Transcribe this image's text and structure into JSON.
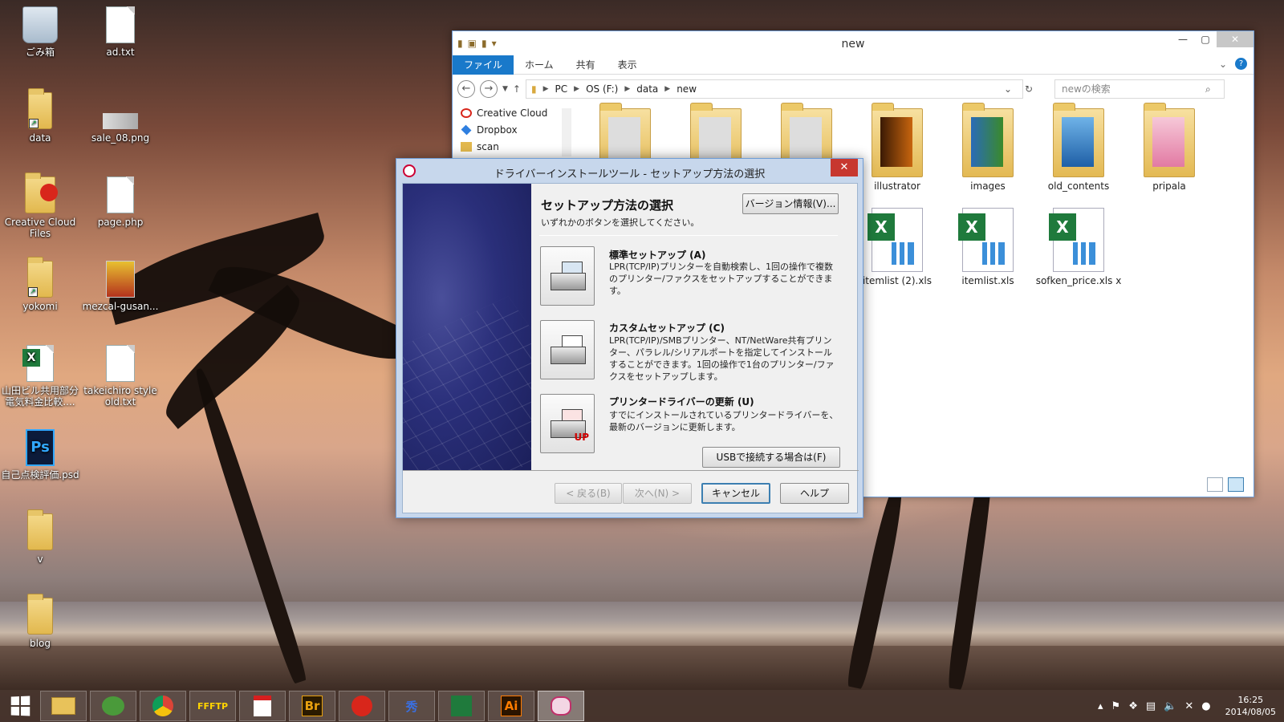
{
  "desktop": {
    "icons": [
      {
        "label": "ごみ箱"
      },
      {
        "label": "ad.txt"
      },
      {
        "label": "data"
      },
      {
        "label": "sale_08.png"
      },
      {
        "label": "Creative Cloud Files"
      },
      {
        "label": "page.php"
      },
      {
        "label": "yokomi"
      },
      {
        "label": "mezcal-gusan..."
      },
      {
        "label": "山田ビル共用部分電気料金比較...."
      },
      {
        "label": "takeichiro style old.txt"
      },
      {
        "label": "自己点検評価.psd"
      },
      {
        "label": "v"
      },
      {
        "label": "blog"
      }
    ],
    "psd_badge": "Ps"
  },
  "explorer": {
    "title": "new",
    "ribbon_tabs": [
      "ファイル",
      "ホーム",
      "共有",
      "表示"
    ],
    "breadcrumb": [
      "PC",
      "OS (F:)",
      "data",
      "new"
    ],
    "search_placeholder": "newの検索",
    "nav_items": [
      "Creative Cloud",
      "Dropbox",
      "scan"
    ],
    "files": [
      {
        "name": ""
      },
      {
        "name": ""
      },
      {
        "name": ""
      },
      {
        "name": "illustrator"
      },
      {
        "name": "images"
      },
      {
        "name": "old_contents"
      },
      {
        "name": "pripala"
      },
      {
        "name": "itemlist (2).xls"
      },
      {
        "name": "itemlist.xls"
      },
      {
        "name": "sofken_price.xls x"
      }
    ]
  },
  "dialog": {
    "title": "ドライバーインストールツール - セットアップ方法の選択",
    "heading": "セットアップ方法の選択",
    "subheading": "いずれかのボタンを選択してください。",
    "version_button": "バージョン情報(V)...",
    "options": [
      {
        "title": "標準セットアップ (A)",
        "desc": "LPR(TCP/IP)プリンターを自動検索し、1回の操作で複数のプリンター/ファクスをセットアップすることができます。"
      },
      {
        "title": "カスタムセットアップ (C)",
        "desc": "LPR(TCP/IP)/SMBプリンター、NT/NetWare共有プリンター、パラレル/シリアルポートを指定してインストールすることができます。1回の操作で1台のプリンター/ファクスをセットアップします。"
      },
      {
        "title": "プリンタードライバーの更新 (U)",
        "desc": "すでにインストールされているプリンタードライバーを、最新のバージョンに更新します。"
      }
    ],
    "usb_button": "USBで接続する場合は(F)",
    "back_button": "< 戻る(B)",
    "next_button": "次へ(N) >",
    "cancel_button": "キャンセル",
    "help_button": "ヘルプ",
    "update_badge": "UP"
  },
  "taskbar": {
    "apps": [
      "",
      "",
      "",
      "FFFTP",
      "",
      "Br",
      "",
      "秀",
      "",
      "Ai",
      ""
    ],
    "clock_time": "16:25",
    "clock_date": "2014/08/05"
  }
}
